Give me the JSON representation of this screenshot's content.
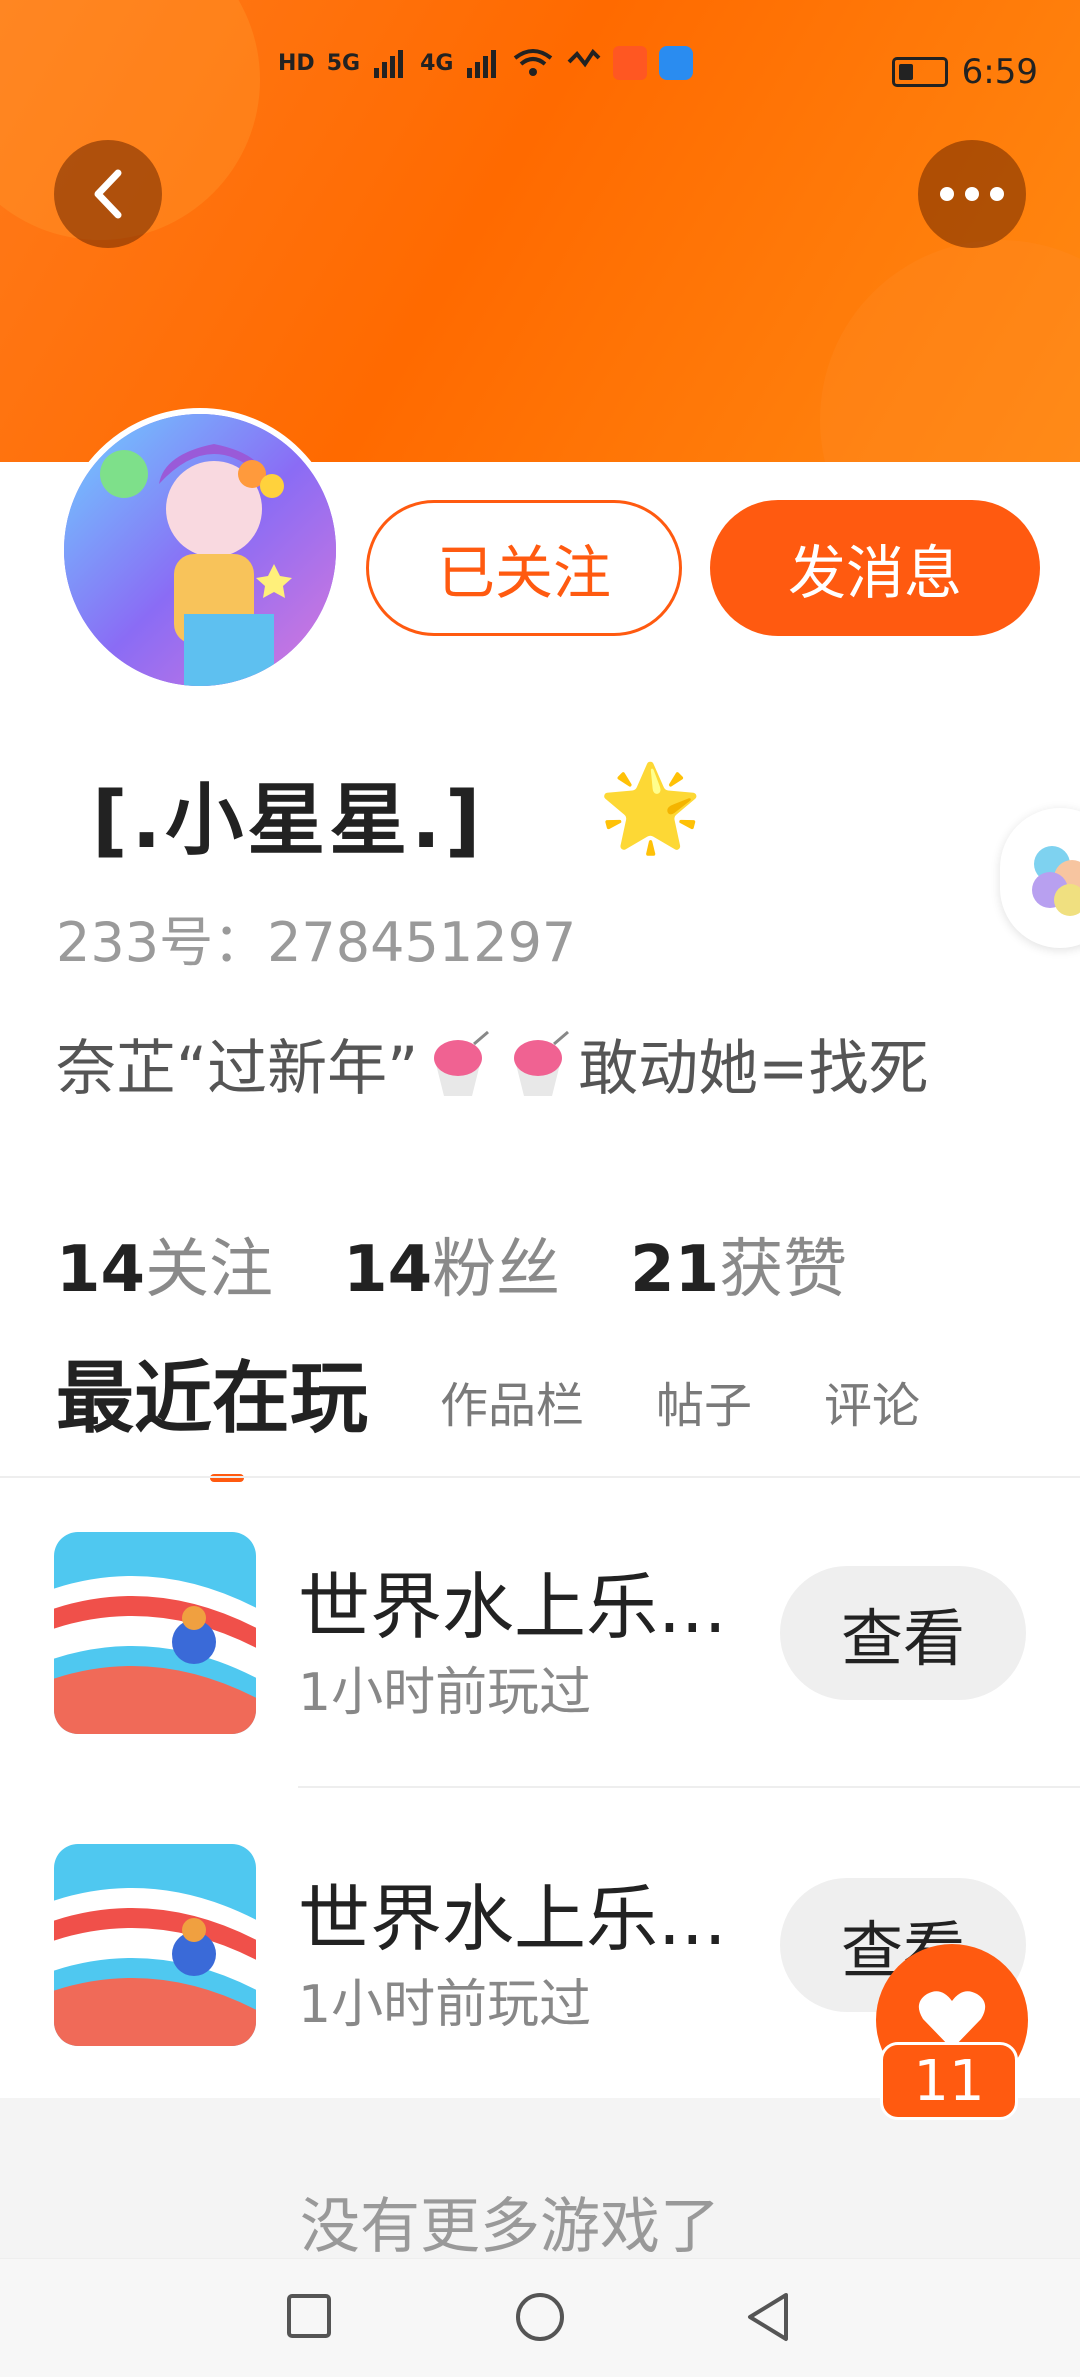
{
  "status_bar": {
    "time": "6:59",
    "network_labels": [
      "HD",
      "5G",
      "4G"
    ]
  },
  "header": {
    "back_icon": "chevron-left-icon",
    "more_icon": "more-dots-icon"
  },
  "profile": {
    "follow_button": "已关注",
    "message_button": "发消息",
    "name": "[.小星星.]",
    "badge": "🌟",
    "id_line": "233号：278451297",
    "bio_prefix": "奈芷“过新年”",
    "bio_suffix": "敢动她=找死",
    "stats": [
      {
        "count": "14",
        "label": "关注"
      },
      {
        "count": "14",
        "label": "粉丝"
      },
      {
        "count": "21",
        "label": "获赞"
      }
    ]
  },
  "tabs": {
    "active": "最近在玩",
    "items": [
      "作品栏",
      "帖子",
      "评论"
    ]
  },
  "games": [
    {
      "title": "世界水上乐...",
      "subtitle": "1小时前玩过",
      "button": "查看"
    },
    {
      "title": "世界水上乐...",
      "subtitle": "1小时前玩过",
      "button": "查看"
    }
  ],
  "footer": {
    "no_more": "没有更多游戏了"
  },
  "fab": {
    "count": "11"
  },
  "colors": {
    "accent": "#ff5a10",
    "header": "#ff7a1a"
  }
}
